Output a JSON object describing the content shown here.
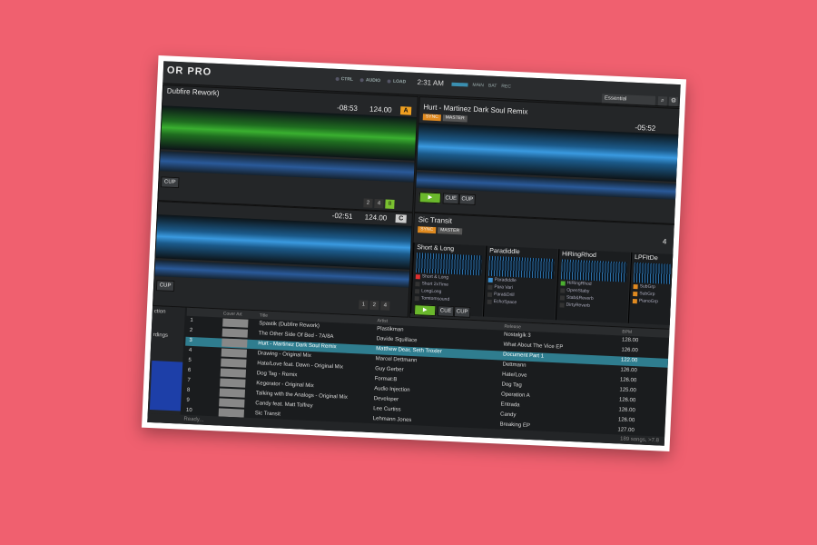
{
  "app": {
    "logo": "OR PRO",
    "clock": "2:31 AM",
    "layout": "Essential"
  },
  "status_labels": [
    "CTRL",
    "AUDIO",
    "LOAD",
    "MAIN",
    "BAT",
    "REC"
  ],
  "deck_a": {
    "title": "Dubfire Rework)",
    "time": "-08:53",
    "bpm": "124.00",
    "letter": "A",
    "cup": "CUP",
    "loops": [
      "2",
      "4",
      "8"
    ]
  },
  "deck_b": {
    "title": "Hurt - Martinez Dark Soul Remix",
    "sync": "SYNC",
    "master": "MASTER",
    "time": "-05:52",
    "cue": "CUE",
    "cup": "CUP"
  },
  "deck_c": {
    "time": "-02:51",
    "bpm": "124.00",
    "letter": "C",
    "cup": "CUP",
    "loops": [
      "1",
      "2",
      "4"
    ]
  },
  "deck_d": {
    "title": "Sic Transit",
    "sync": "SYNC",
    "master": "MASTER",
    "number": "4",
    "cue": "CUE",
    "cup": "CUP"
  },
  "samples": [
    {
      "name": "Short & Long",
      "items": [
        "Short & Long",
        "Short 2xTime",
        "LongLong",
        "Tomtomsound"
      ]
    },
    {
      "name": "Paradiddle",
      "items": [
        "Paradiddle",
        "Para Vari",
        "Para&Drill",
        "EchoSpace"
      ]
    },
    {
      "name": "HiRingRhod",
      "items": [
        "HiRingRhod",
        "OpenStaby",
        "Stab&Reverb",
        "DirtyReverb"
      ]
    },
    {
      "name": "LPFItDe",
      "items": [
        "SubGrp",
        "SubGrp",
        "PianoGrp"
      ]
    }
  ],
  "sidebar": {
    "items": [
      "ction",
      "rdings"
    ]
  },
  "columns": {
    "cover": "Cover Art",
    "title": "Title",
    "artist": "Artist",
    "release": "Release",
    "bpm": "BPM"
  },
  "tracks": [
    {
      "n": "1",
      "title": "Spastik (Dubfire Rework)",
      "artist": "Plastikman",
      "release": "Nostalgik 3",
      "bpm": "128.00"
    },
    {
      "n": "2",
      "title": "The Other Side Of Bed - 7A/8A",
      "artist": "Davide Squillace",
      "release": "What About The Vice EP",
      "bpm": "126.00"
    },
    {
      "n": "3",
      "title": "Hurt - Martinez Dark Soul Remix",
      "artist": "Matthew Dear, Seth Troxler",
      "release": "Document Part 1",
      "bpm": "122.00"
    },
    {
      "n": "4",
      "title": "Drawing - Original Mix",
      "artist": "Marcel Dettmann",
      "release": "Dettmann",
      "bpm": "126.00"
    },
    {
      "n": "5",
      "title": "Hate/Love feat. Dawn - Original Mix",
      "artist": "Guy Gerber",
      "release": "Hate/Love",
      "bpm": "126.00"
    },
    {
      "n": "6",
      "title": "Dog Tag - Remix",
      "artist": "Format:B",
      "release": "Dog Tag",
      "bpm": "125.00"
    },
    {
      "n": "7",
      "title": "Kegerator - Original Mix",
      "artist": "Audio Injection",
      "release": "Operation A",
      "bpm": "126.00"
    },
    {
      "n": "8",
      "title": "Talking with the Analogs - Original Mix",
      "artist": "Developer",
      "release": "Entrada",
      "bpm": "126.00"
    },
    {
      "n": "9",
      "title": "Candy feat. Matt Tolfrey",
      "artist": "Lee Curtiss",
      "release": "Candy",
      "bpm": "126.00"
    },
    {
      "n": "10",
      "title": "Sic Transit",
      "artist": "Lehmann Jones",
      "release": "Breaking EP",
      "bpm": "127.00"
    }
  ],
  "trailing_bpm": "124.00",
  "status": {
    "left": "Ready...",
    "right": "189 songs, >7.8"
  }
}
